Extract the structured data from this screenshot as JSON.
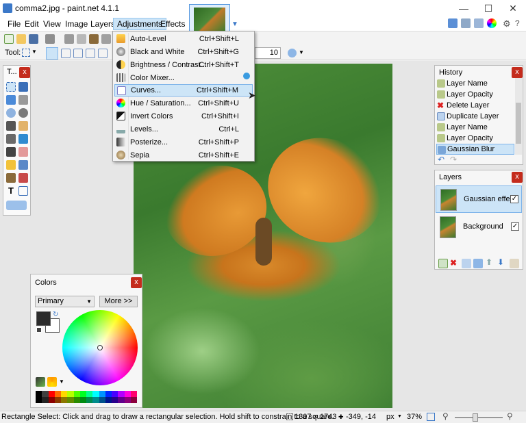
{
  "window": {
    "title": "comma2.jpg - paint.net 4.1.1",
    "minimize_icon": "minimize-icon",
    "maximize_icon": "maximize-icon",
    "close_icon": "close-icon"
  },
  "menubar": {
    "items": [
      "File",
      "Edit",
      "View",
      "Image",
      "Layers",
      "Adjustments",
      "Effects"
    ],
    "active": "Adjustments"
  },
  "toolbar": {
    "tool_label": "Tool:",
    "brush_width_value": "10"
  },
  "adjustments_menu": {
    "items": [
      {
        "label": "Auto-Level",
        "shortcut": "Ctrl+Shift+L",
        "icon": "auto-level-icon"
      },
      {
        "label": "Black and White",
        "shortcut": "Ctrl+Shift+G",
        "icon": "black-white-icon"
      },
      {
        "label": "Brightness / Contrast...",
        "shortcut": "Ctrl+Shift+T",
        "icon": "brightness-icon"
      },
      {
        "label": "Color Mixer...",
        "shortcut": "",
        "icon": "color-mixer-icon"
      },
      {
        "label": "Curves...",
        "shortcut": "Ctrl+Shift+M",
        "icon": "curves-icon",
        "highlighted": true
      },
      {
        "label": "Hue / Saturation...",
        "shortcut": "Ctrl+Shift+U",
        "icon": "hue-saturation-icon"
      },
      {
        "label": "Invert Colors",
        "shortcut": "Ctrl+Shift+I",
        "icon": "invert-colors-icon"
      },
      {
        "label": "Levels...",
        "shortcut": "Ctrl+L",
        "icon": "levels-icon"
      },
      {
        "label": "Posterize...",
        "shortcut": "Ctrl+Shift+P",
        "icon": "posterize-icon"
      },
      {
        "label": "Sepia",
        "shortcut": "Ctrl+Shift+E",
        "icon": "sepia-icon"
      }
    ]
  },
  "tools_panel": {
    "title": "T..."
  },
  "history_panel": {
    "title": "History",
    "items": [
      {
        "label": "Layer Name",
        "icon": "layer-properties-icon"
      },
      {
        "label": "Layer Opacity",
        "icon": "layer-properties-icon"
      },
      {
        "label": "Delete Layer",
        "icon": "delete-icon"
      },
      {
        "label": "Duplicate Layer",
        "icon": "duplicate-layer-icon"
      },
      {
        "label": "Layer Name",
        "icon": "layer-properties-icon"
      },
      {
        "label": "Layer Opacity",
        "icon": "layer-properties-icon"
      },
      {
        "label": "Gaussian Blur",
        "icon": "gaussian-blur-icon",
        "selected": true
      }
    ]
  },
  "layers_panel": {
    "title": "Layers",
    "layers": [
      {
        "name": "Gaussian effect",
        "visible": true,
        "selected": true
      },
      {
        "name": "Background",
        "visible": true,
        "selected": false
      }
    ]
  },
  "colors_panel": {
    "title": "Colors",
    "mode": "Primary",
    "more_button": "More >>",
    "primary_color": "#2b2b2b",
    "secondary_color": "#ffffff",
    "palette": [
      "#000000",
      "#404040",
      "#ff0000",
      "#ff6a00",
      "#ffd800",
      "#b6ff00",
      "#4cff00",
      "#00ff21",
      "#00ff90",
      "#00ffff",
      "#0094ff",
      "#0026ff",
      "#4800ff",
      "#b200ff",
      "#ff00dc",
      "#ff006e"
    ]
  },
  "statusbar": {
    "hint": "Rectangle Select: Click and drag to draw a rectangular selection. Hold shift to constrain to a square.",
    "image_size": "1307 × 1743",
    "cursor_position": "-349, -14",
    "units": "px",
    "zoom": "37%"
  }
}
